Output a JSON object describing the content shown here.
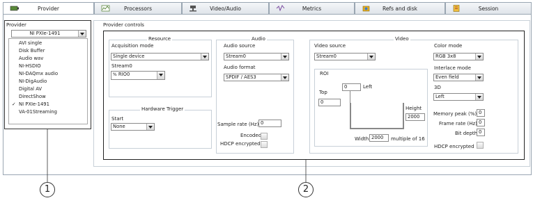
{
  "tabs": [
    {
      "label": "Provider",
      "icon": "provider-icon",
      "active": true
    },
    {
      "label": "Processors",
      "icon": "processors-icon"
    },
    {
      "label": "Video/Audio",
      "icon": "video-audio-icon"
    },
    {
      "label": "Metrics",
      "icon": "metrics-icon"
    },
    {
      "label": "Refs and disk",
      "icon": "refs-disk-icon"
    },
    {
      "label": "Session",
      "icon": "session-icon"
    }
  ],
  "provider": {
    "label": "Provider",
    "selected": "NI PXIe-1491",
    "options": [
      "AVI single",
      "Disk Buffer",
      "Audio wav",
      "NI-HSDIO",
      "NI-DAQmx audio",
      "NI-DigAudio",
      "Digital AV",
      "DirectShow",
      "NI PXIe-1491",
      "VA-01Streaming"
    ],
    "checked_index": 8,
    "checkmark": "✓"
  },
  "controls": {
    "title": "Provider controls",
    "resource": {
      "title": "Resource",
      "acq_mode_label": "Acquisition mode",
      "acq_mode_value": "Single device",
      "stream_label": "Stream0",
      "stream_value": "RIO0",
      "stream_prefix": "%"
    },
    "trigger": {
      "title": "Hardware Trigger",
      "start_label": "Start",
      "start_value": "None"
    },
    "audio": {
      "title": "Audio",
      "source_label": "Audio source",
      "source_value": "Stream0",
      "format_label": "Audio format",
      "format_value": "SPDIF / AES3",
      "sample_rate_label": "Sample rate (Hz)",
      "sample_rate_value": "0",
      "encoded_label": "Encoded",
      "hdcp_label": "HDCP encrypted"
    },
    "video": {
      "title": "Video",
      "source_label": "Video source",
      "source_value": "Stream0",
      "roi_label": "ROI",
      "top_label": "Top",
      "top_value": "0",
      "left_label": "Left",
      "left_value": "0",
      "height_label": "Height",
      "height_value": "2000",
      "width_label": "Width",
      "width_value": "2000",
      "multiple_label": "multiple of 16",
      "color_mode_label": "Color mode",
      "color_mode_value": "RGB 3x8",
      "interlace_label": "Interlace mode",
      "interlace_value": "Even field",
      "three_d_label": "3D",
      "three_d_value": "Left",
      "mem_peak_label": "Memory peak (%)",
      "mem_peak_value": "0",
      "frame_rate_label": "Frame rate (Hz)",
      "frame_rate_value": "0",
      "bit_depth_label": "Bit depth",
      "bit_depth_value": "0",
      "hdcp_label": "HDCP encrypted"
    }
  },
  "callouts": [
    "1",
    "2"
  ]
}
